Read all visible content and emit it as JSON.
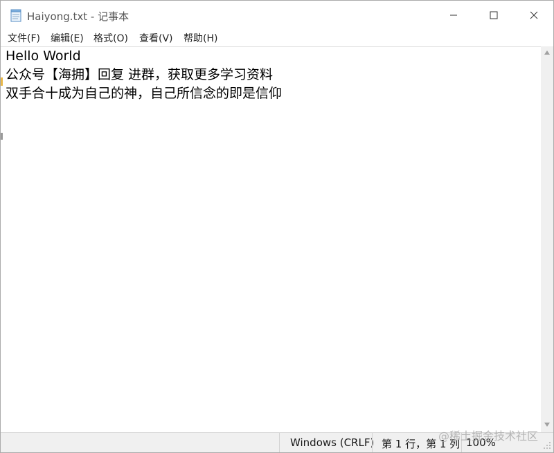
{
  "window": {
    "title": "Haiyong.txt - 记事本"
  },
  "menu": {
    "items": [
      {
        "label": "文件(F)"
      },
      {
        "label": "编辑(E)"
      },
      {
        "label": "格式(O)"
      },
      {
        "label": "查看(V)"
      },
      {
        "label": "帮助(H)"
      }
    ]
  },
  "editor": {
    "lines": [
      "Hello World",
      "公众号【海拥】回复 进群，获取更多学习资料",
      "双手合十成为自己的神，自己所信念的即是信仰"
    ]
  },
  "status": {
    "line_ending": "Windows (CRLF)",
    "position": "第 1 行，第 1 列",
    "zoom": "100%"
  },
  "watermark": {
    "text": "@稀土掘金技术社区"
  },
  "icons": {
    "app": "notepad-icon",
    "minimize": "minimize-icon",
    "maximize": "maximize-icon",
    "close": "close-icon"
  },
  "colors": {
    "accent_mark": "#e9b84a",
    "statusbar": "#f0f0f0"
  }
}
